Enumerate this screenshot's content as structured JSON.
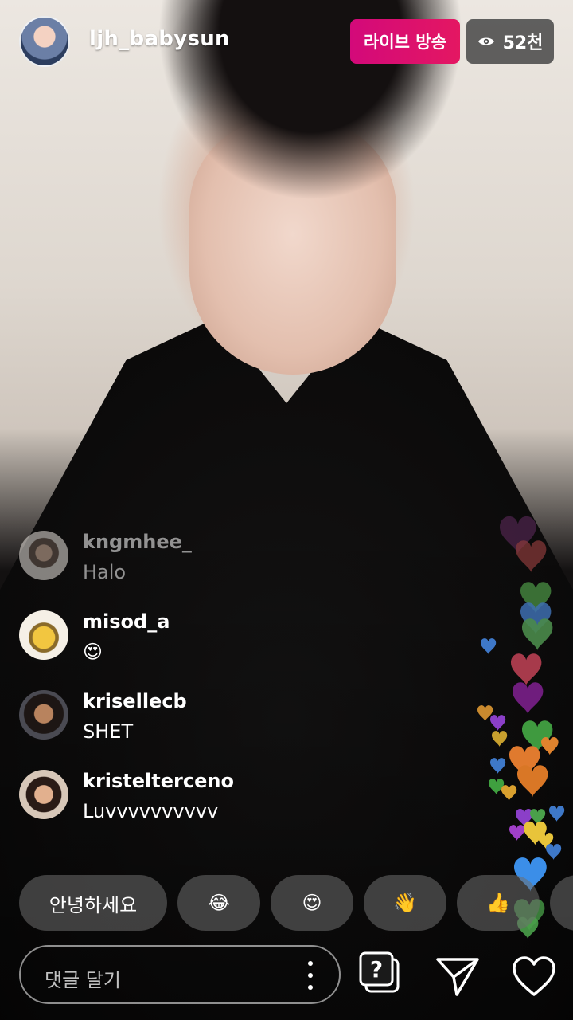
{
  "host": {
    "username": "ljh_babysun"
  },
  "badges": {
    "live_label": "라이브 방송",
    "viewer_count": "52천",
    "live_color": "#d3097a"
  },
  "comments": [
    {
      "user": "kngmhee_",
      "text": "Halo",
      "faded": true
    },
    {
      "user": "misod_a",
      "text": "😍",
      "faded": false
    },
    {
      "user": "krisellecb",
      "text": "SHET",
      "faded": false
    },
    {
      "user": "kristelterceno",
      "text": "Luvvvvvvvvvv",
      "faded": false
    }
  ],
  "quick_replies": [
    "안녕하세요",
    "😂",
    "😍",
    "👋",
    "👍"
  ],
  "input": {
    "placeholder": "댓글 달기"
  },
  "icons": {
    "question_sticker": "question-sticker-icon",
    "share": "paper-plane-icon",
    "like": "heart-outline-icon",
    "more": "vertical-dots-icon",
    "viewers": "eye-icon"
  }
}
